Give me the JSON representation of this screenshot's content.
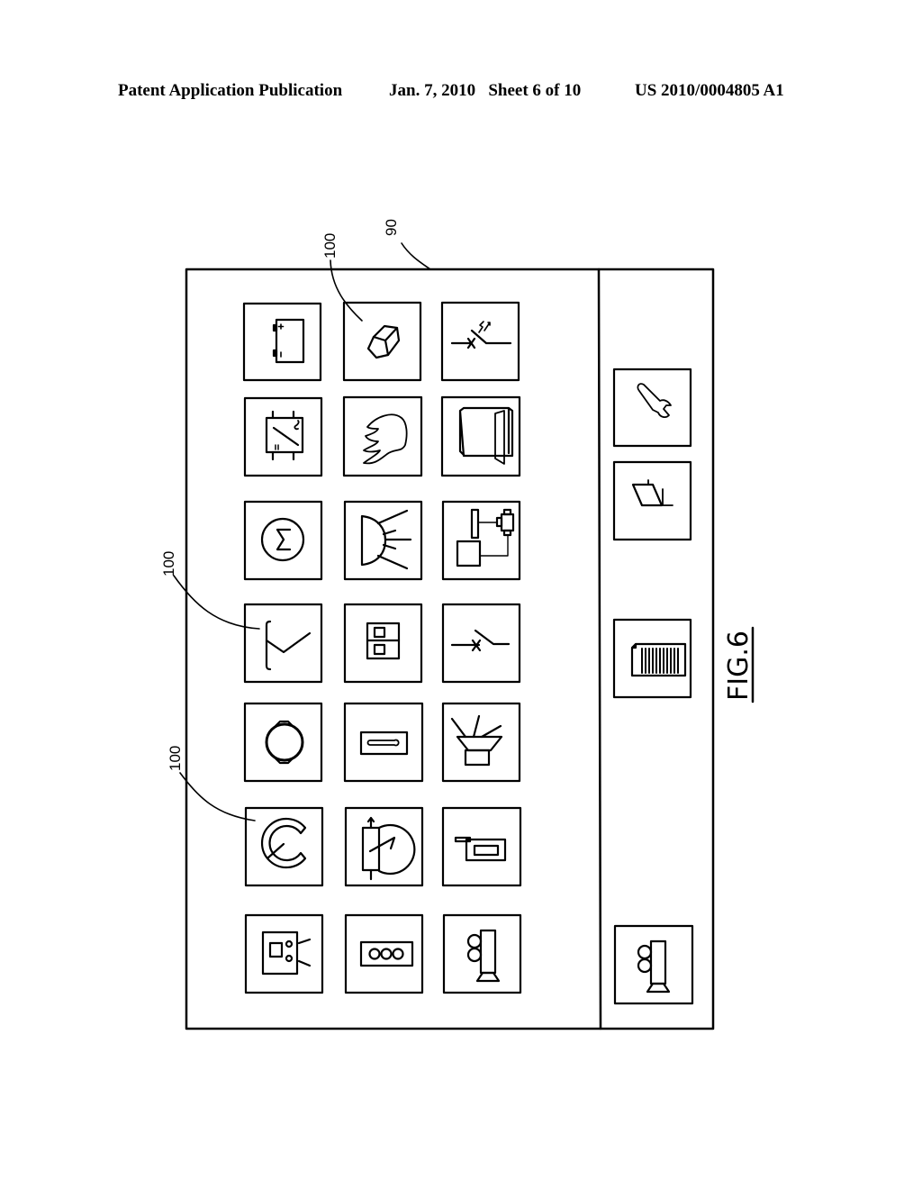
{
  "header": {
    "publication": "Patent Application Publication",
    "date_sheet": "Jan. 7, 2010   Sheet 6 of 10",
    "patent_number": "US 2010/0004805 A1"
  },
  "figure": {
    "label": "FIG.6",
    "ref_screen": "90",
    "ref_icon_top": "100",
    "ref_icon_mid": "100",
    "ref_icon_low": "100"
  },
  "main_panel": {
    "icons": [
      [
        "battery-icon",
        "converter-icon",
        "motor-icon",
        "antenna-icon",
        "wheel-icon",
        "gauge-icon",
        "display-icon"
      ],
      [
        "cube-icon",
        "flame-icon",
        "headlight-icon",
        "switch-panel-icon",
        "thermometer-icon",
        "rheostat-icon",
        "three-lights-icon"
      ],
      [
        "breaker-arrow-icon",
        "door-icon",
        "circuit-icon",
        "breaker-icon",
        "horn-icon",
        "key-card-icon",
        "camera-icon"
      ]
    ]
  },
  "side_panel": {
    "icons": [
      "wrench-icon",
      "shunt-icon",
      "barcode-icon",
      "camera-icon"
    ]
  }
}
